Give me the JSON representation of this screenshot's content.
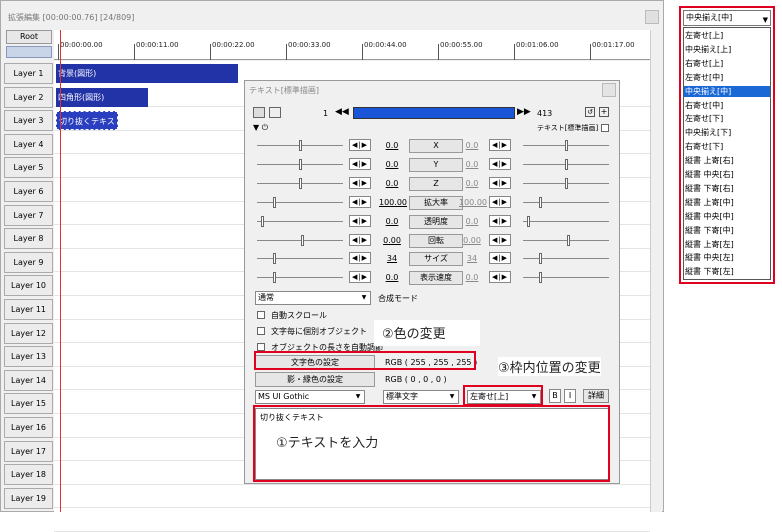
{
  "timeline": {
    "title": "拡張編集 [00:00:00.76] [24/809]",
    "root_label": "Root",
    "time_labels": [
      "00:00:00.00",
      "00:00:11.00",
      "00:00:22.00",
      "00:00:33.00",
      "00:00:44.00",
      "00:00:55.00",
      "00:01:06.00",
      "00:01:17.00"
    ],
    "layers": [
      "Layer 1",
      "Layer 2",
      "Layer 3",
      "Layer 4",
      "Layer 5",
      "Layer 6",
      "Layer 7",
      "Layer 8",
      "Layer 9",
      "Layer 10",
      "Layer 11",
      "Layer 12",
      "Layer 13",
      "Layer 14",
      "Layer 15",
      "Layer 16",
      "Layer 17",
      "Layer 18",
      "Layer 19"
    ],
    "clips": [
      "背景(図形)",
      "四角形(図形)",
      "切り抜くテキスト"
    ]
  },
  "dialog": {
    "title": "テキスト[標準描画]",
    "frame_start": "1",
    "frame_end": "413",
    "object_name": "テキスト[標準描画]",
    "params": [
      {
        "label": "X",
        "left": "0.0",
        "right": "0.0"
      },
      {
        "label": "Y",
        "left": "0.0",
        "right": "0.0"
      },
      {
        "label": "Z",
        "left": "0.0",
        "right": "0.0"
      },
      {
        "label": "拡大率",
        "left": "100.00",
        "right": "100.00"
      },
      {
        "label": "透明度",
        "left": "0.0",
        "right": "0.0"
      },
      {
        "label": "回転",
        "left": "0.00",
        "right": "0.00"
      },
      {
        "label": "サイズ",
        "left": "34",
        "right": "34"
      },
      {
        "label": "表示速度",
        "left": "0.0",
        "right": "0.0"
      }
    ],
    "blend_mode": "通常",
    "blend_label": "合成モード",
    "checkboxes": [
      "自動スクロール",
      "文字毎に個別オブジェクト",
      "オブジェクトの長さを自動調節"
    ],
    "text_color_button": "文字色の設定",
    "text_color_value": "RGB ( 255 , 255 , 255 )",
    "shadow_color_button": "影・縁色の設定",
    "shadow_color_value": "RGB ( 0 , 0 , 0 )",
    "font": "MS UI Gothic",
    "style": "標準文字",
    "align": "左寄せ[上]",
    "bold": "B",
    "italic": "I",
    "detail": "詳細",
    "text_content": "切り抜くテキスト"
  },
  "annotations": {
    "color_change": "②色の変更",
    "position_change": "③枠内位置の変更",
    "enter_text": "①テキストを入力"
  },
  "dropdown": {
    "selected": "中央揃え[中]",
    "options": [
      "左寄せ[上]",
      "中央揃え[上]",
      "右寄せ[上]",
      "左寄せ[中]",
      "中央揃え[中]",
      "右寄せ[中]",
      "左寄せ[下]",
      "中央揃え[下]",
      "右寄せ[下]",
      "縦書 上寄[右]",
      "縦書 中央[右]",
      "縦書 下寄[右]",
      "縦書 上寄[中]",
      "縦書 中央[中]",
      "縦書 下寄[中]",
      "縦書 上寄[左]",
      "縦書 中央[左]",
      "縦書 下寄[左]"
    ],
    "selected_index": 4
  },
  "colors": {
    "accent_red": "#e00020",
    "clip_blue": "#2233a8",
    "selection_blue": "#1a68d6"
  }
}
